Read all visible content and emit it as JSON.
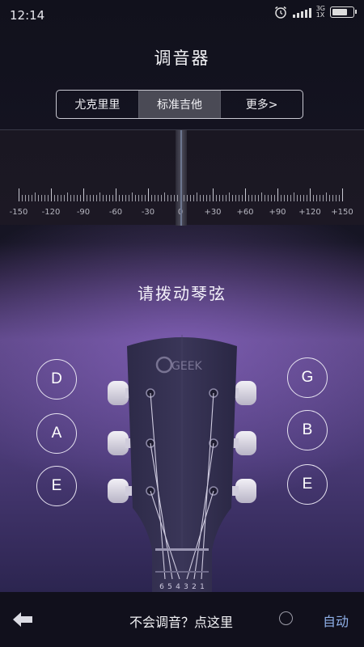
{
  "status": {
    "time": "12:14",
    "network_top": "3G",
    "network_bottom": "1X"
  },
  "header": {
    "title": "调音器"
  },
  "mode_tabs": [
    {
      "label": "尤克里里",
      "active": false
    },
    {
      "label": "标准吉他",
      "active": true
    },
    {
      "label": "更多>",
      "active": false
    }
  ],
  "meter": {
    "labels": [
      "-150",
      "-120",
      "-90",
      "-60",
      "-30",
      "0",
      "+30",
      "+60",
      "+90",
      "+120",
      "+150"
    ],
    "needle_value": 0
  },
  "prompt": {
    "text": "请拨动琴弦"
  },
  "strings": {
    "left": [
      "D",
      "A",
      "E"
    ],
    "right": [
      "G",
      "B",
      "E"
    ],
    "numbers": [
      "6",
      "5",
      "4",
      "3",
      "2",
      "1"
    ]
  },
  "headstock": {
    "logo": "GEEK"
  },
  "bottom": {
    "help": "不会调音？点这里",
    "auto_label": "自动",
    "auto_checked": false
  },
  "colors": {
    "accent": "#8fb0e8",
    "bg_dark": "#11101c",
    "purple": "#5a4583"
  }
}
